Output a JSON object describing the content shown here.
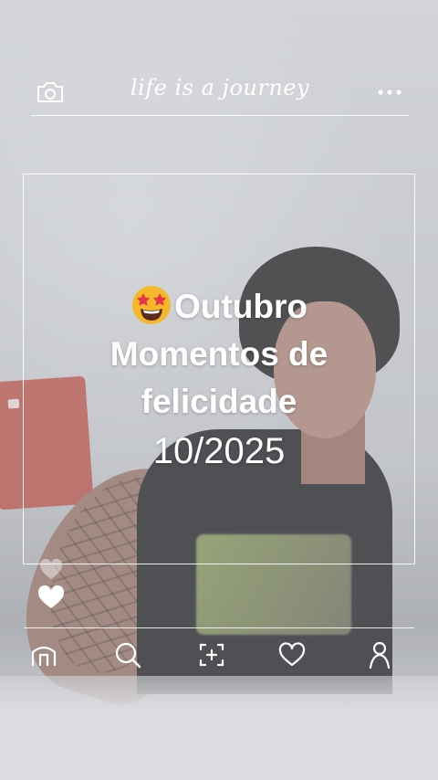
{
  "header": {
    "tagline": "life is a journey",
    "camera_icon": "camera-icon",
    "more_icon": "more-dots-icon"
  },
  "caption": {
    "emoji": "star-struck-emoji",
    "line1": "Outubro",
    "line2": "Momentos de",
    "line3": "felicidade",
    "date": "10/2025"
  },
  "reactions": {
    "icon": "heart-icon"
  },
  "nav": {
    "items": [
      {
        "icon": "home-icon"
      },
      {
        "icon": "search-icon"
      },
      {
        "icon": "add-post-icon"
      },
      {
        "icon": "heart-icon"
      },
      {
        "icon": "profile-icon"
      }
    ]
  },
  "colors": {
    "overlay_line": "#ffffff",
    "text": "#ffffff"
  }
}
